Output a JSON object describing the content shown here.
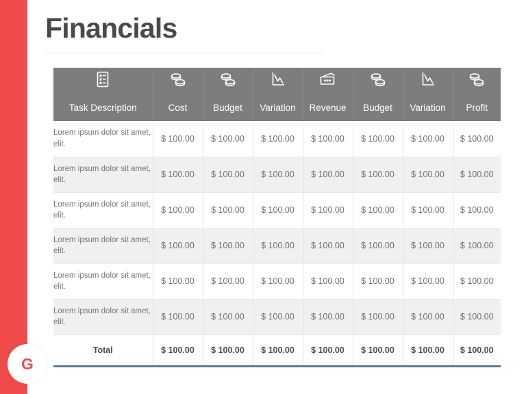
{
  "slide": {
    "title": "Financials",
    "logo_letter": "G",
    "accent_color": "#ef4b4b",
    "title_color": "#4a4a4a",
    "header_bg_color": "#7d7d7d",
    "total_rule_color": "#5b7b96",
    "row_alt_color": "#f0f0f0"
  },
  "table": {
    "columns": [
      {
        "label": "Task Description",
        "icon": "document-list-icon"
      },
      {
        "label": "Cost",
        "icon": "coin-stack-icon"
      },
      {
        "label": "Budget",
        "icon": "coin-stack-icon"
      },
      {
        "label": "Variation",
        "icon": "line-chart-icon"
      },
      {
        "label": "Revenue",
        "icon": "banknote-icon"
      },
      {
        "label": "Budget",
        "icon": "coin-stack-icon"
      },
      {
        "label": "Variation",
        "icon": "line-chart-icon"
      },
      {
        "label": "Profit",
        "icon": "coin-stack-icon"
      }
    ],
    "rows": [
      {
        "description": "Lorem ipsum dolor sit amet, elit.",
        "values": [
          "$ 100.00",
          "$ 100.00",
          "$ 100.00",
          "$ 100.00",
          "$ 100.00",
          "$ 100.00",
          "$ 100.00"
        ]
      },
      {
        "description": "Lorem ipsum dolor sit amet, elit.",
        "values": [
          "$ 100.00",
          "$ 100.00",
          "$ 100.00",
          "$ 100.00",
          "$ 100.00",
          "$ 100.00",
          "$ 100.00"
        ]
      },
      {
        "description": "Lorem ipsum dolor sit amet, elit.",
        "values": [
          "$ 100.00",
          "$ 100.00",
          "$ 100.00",
          "$ 100.00",
          "$ 100.00",
          "$ 100.00",
          "$ 100.00"
        ]
      },
      {
        "description": "Lorem ipsum dolor sit amet, elit.",
        "values": [
          "$ 100.00",
          "$ 100.00",
          "$ 100.00",
          "$ 100.00",
          "$ 100.00",
          "$ 100.00",
          "$ 100.00"
        ]
      },
      {
        "description": "Lorem ipsum dolor sit amet, elit.",
        "values": [
          "$ 100.00",
          "$ 100.00",
          "$ 100.00",
          "$ 100.00",
          "$ 100.00",
          "$ 100.00",
          "$ 100.00"
        ]
      },
      {
        "description": "Lorem ipsum dolor sit amet, elit.",
        "values": [
          "$ 100.00",
          "$ 100.00",
          "$ 100.00",
          "$ 100.00",
          "$ 100.00",
          "$ 100.00",
          "$ 100.00"
        ]
      }
    ],
    "total": {
      "label": "Total",
      "values": [
        "$ 100.00",
        "$ 100.00",
        "$ 100.00",
        "$ 100.00",
        "$ 100.00",
        "$ 100.00",
        "$ 100.00"
      ]
    }
  }
}
